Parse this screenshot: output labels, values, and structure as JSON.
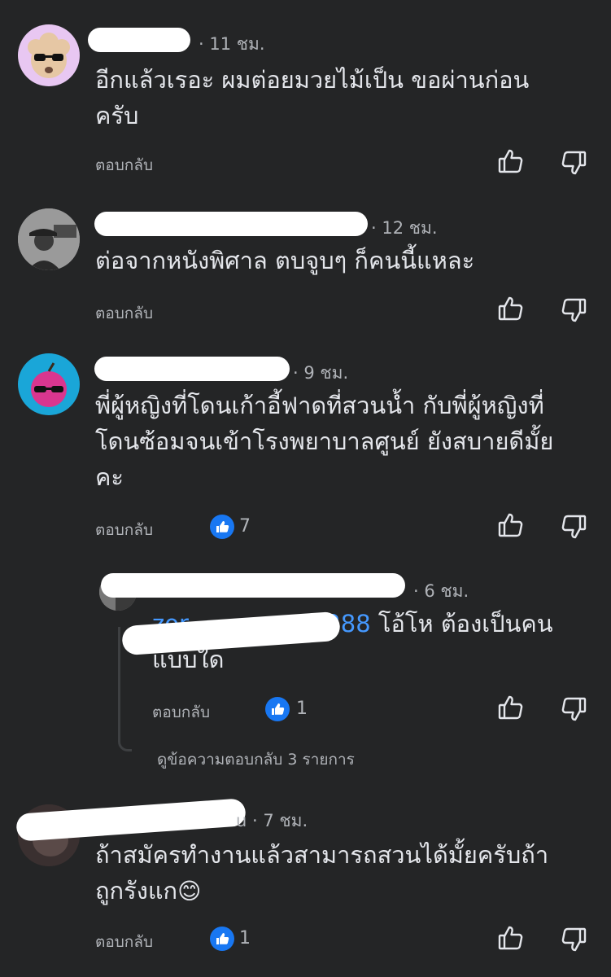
{
  "comments": [
    {
      "time": "· 11 ชม.",
      "text_line1": "อีกแล้วเรอะ ผมต่อยมวยไม้เป็น ขอผ่านก่อน",
      "text_line2": "ครับ",
      "reply_label": "ตอบกลับ",
      "like_count": ""
    },
    {
      "time": "· 12 ชม.",
      "text_line1": "ต่อจากหนังพิศาล ตบจูบๆ ก็คนนี้แหละ",
      "reply_label": "ตอบกลับ",
      "like_count": ""
    },
    {
      "time": "· 9 ชม.",
      "text_line1": "พี่ผู้หญิงที่โดนเก้าอี้ฟาดที่สวนน้ำ กับพี่ผู้หญิงที่",
      "text_line2": "โดนซ้อมจนเข้าโรงพยาบาลศูนย์ ยังสบายดีมั้ย",
      "text_line3": "คะ",
      "reply_label": "ตอบกลับ",
      "like_count": "7"
    },
    {
      "time": "· 6 ชม.",
      "mention": "zor",
      "mention_tail": "1288",
      "text_line1": " โอ้โห ต้องเป็นคน",
      "text_line2": "แบบใด",
      "reply_label": "ตอบกลับ",
      "like_count": "1"
    },
    {
      "time": "u · 7 ชม.",
      "text_line1": "ถ้าสมัครทำงานแล้วสามารถสวนได้มั้ยครับถ้า",
      "text_line2": "ถูกรังแก",
      "emoji": "😊",
      "reply_label": "ตอบกลับ",
      "like_count": "1"
    }
  ],
  "view_replies": "ดูข้อความตอบกลับ 3 รายการ",
  "colors": {
    "background": "#242526",
    "text": "#e4e6eb",
    "muted": "#b0b3b8",
    "like_badge": "#1877f2",
    "mention": "#4599ff"
  },
  "icons": [
    "thumbs-up-icon",
    "thumbs-down-icon",
    "like-badge-icon"
  ]
}
